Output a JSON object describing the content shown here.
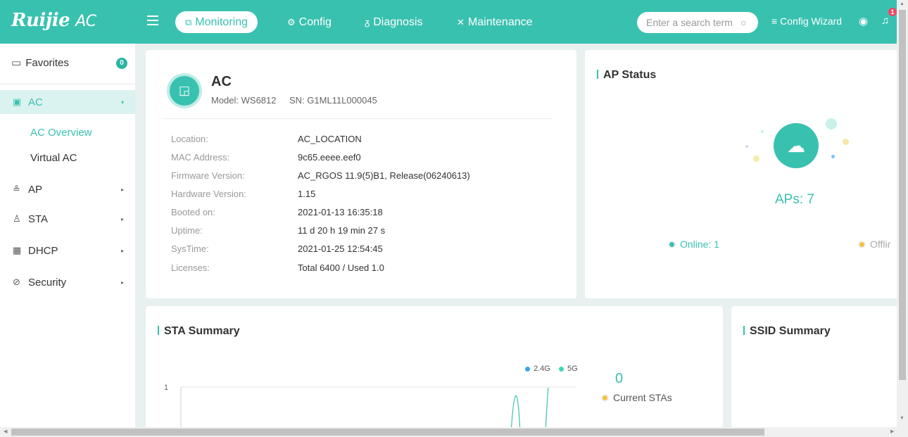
{
  "brand": {
    "logo": "Ruijie",
    "product": "AC"
  },
  "nav": {
    "monitoring": "Monitoring",
    "config": "Config",
    "diagnosis": "Diagnosis",
    "maintenance": "Maintenance"
  },
  "search": {
    "placeholder": "Enter a search term"
  },
  "header": {
    "config_wizard": "Config Wizard",
    "notification_count": "1"
  },
  "sidebar": {
    "favorites": "Favorites",
    "favorites_count": "0",
    "items": [
      {
        "label": "AC",
        "icon": "ac-device-icon"
      },
      {
        "label": "AP",
        "icon": "ap-icon"
      },
      {
        "label": "STA",
        "icon": "user-icon"
      },
      {
        "label": "DHCP",
        "icon": "dhcp-icon"
      },
      {
        "label": "Security",
        "icon": "shield-icon"
      }
    ],
    "ac_sub": [
      "AC Overview",
      "Virtual AC"
    ]
  },
  "ac_card": {
    "title": "AC",
    "model": "Model: WS6812",
    "sn": "SN: G1ML11L000045",
    "fields": [
      {
        "label": "Location:",
        "value": "AC_LOCATION"
      },
      {
        "label": "MAC Address:",
        "value": "9c65.eeee.eef0"
      },
      {
        "label": "Firmware Version:",
        "value": "AC_RGOS 11.9(5)B1, Release(06240613)"
      },
      {
        "label": "Hardware Version:",
        "value": "1.15"
      },
      {
        "label": "Booted on:",
        "value": "2021-01-13 16:35:18"
      },
      {
        "label": "Uptime:",
        "value": "11 d 20 h 19 min 27 s"
      },
      {
        "label": "SysTime:",
        "value": "2021-01-25 12:54:45"
      },
      {
        "label": "Licenses:",
        "value": "Total 6400 / Used 1.0"
      }
    ]
  },
  "ap_status": {
    "title": "AP Status",
    "count_label": "APs: 7",
    "online": "Online: 1",
    "offline": "Offlir"
  },
  "sta_summary": {
    "title": "STA Summary",
    "legend_24g": "2.4G",
    "legend_5g": "5G",
    "current_count": "0",
    "current_label": "Current STAs",
    "y_tick": "1"
  },
  "ssid_summary": {
    "title": "SSID Summary"
  },
  "colors": {
    "accent": "#39c1b0",
    "online": "#39c1b0",
    "offline": "#f5c342",
    "band_24g": "#3aa8e8",
    "band_5g": "#3dd6b5"
  }
}
